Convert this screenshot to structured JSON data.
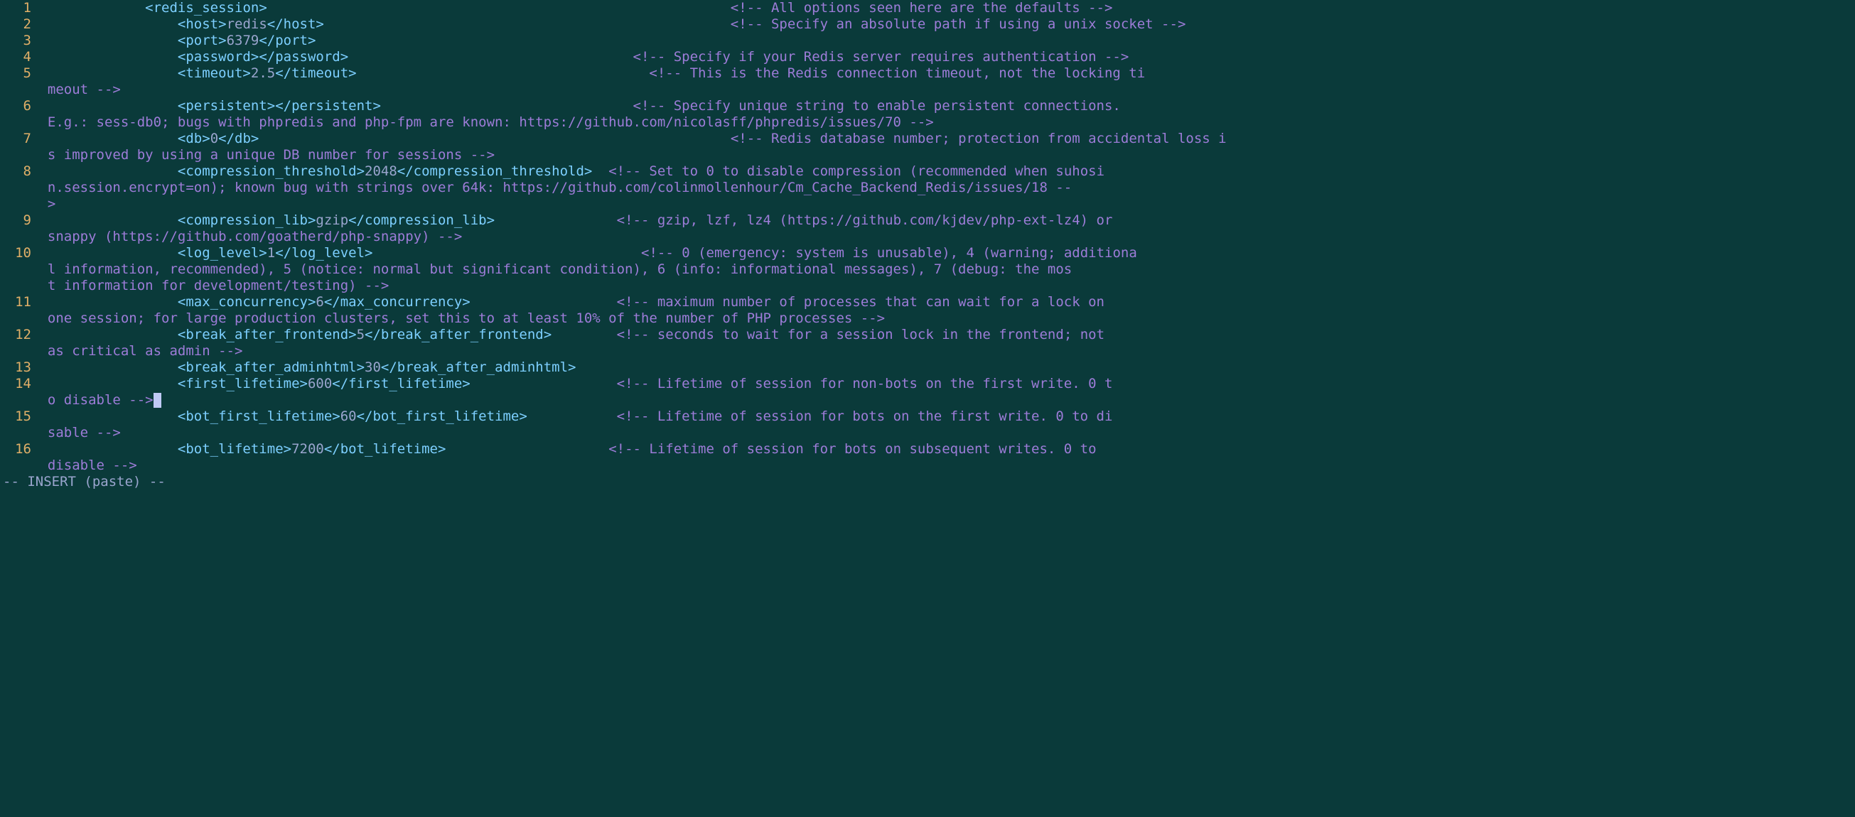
{
  "lines": [
    {
      "n": "1",
      "col1": "            <redis_session>",
      "val": "",
      "close": "",
      "pad": "                                                         ",
      "comment": "<!-- All options seen here are the defaults -->",
      "wraps": []
    },
    {
      "n": "2",
      "col1": "                <host>",
      "val": "redis",
      "close": "</host>",
      "pad": "                                                  ",
      "comment": "<!-- Specify an absolute path if using a unix socket -->",
      "wraps": []
    },
    {
      "n": "3",
      "col1": "                <port>",
      "val": "6379",
      "close": "</port>",
      "pad": "",
      "comment": "",
      "wraps": []
    },
    {
      "n": "4",
      "col1": "                <password>",
      "val": "",
      "close": "</password>",
      "pad": "                                   ",
      "comment": "<!-- Specify if your Redis server requires authentication -->",
      "wraps": []
    },
    {
      "n": "5",
      "col1": "                <timeout>",
      "val": "2.5",
      "close": "</timeout>",
      "pad": "                                    ",
      "comment": "<!-- This is the Redis connection timeout, not the locking ti",
      "wraps": [
        "meout -->"
      ]
    },
    {
      "n": "6",
      "col1": "                <persistent>",
      "val": "",
      "close": "</persistent>",
      "pad": "                               ",
      "comment": "<!-- Specify unique string to enable persistent connections. ",
      "wraps": [
        "E.g.: sess-db0; bugs with phpredis and php-fpm are known: https://github.com/nicolasff/phpredis/issues/70 -->"
      ]
    },
    {
      "n": "7",
      "col1": "                <db>",
      "val": "0",
      "close": "</db>",
      "pad": "                                                          ",
      "comment": "<!-- Redis database number; protection from accidental loss i",
      "wraps": [
        "s improved by using a unique DB number for sessions -->"
      ]
    },
    {
      "n": "8",
      "col1": "                <compression_threshold>",
      "val": "2048",
      "close": "</compression_threshold>",
      "pad": "  ",
      "comment": "<!-- Set to 0 to disable compression (recommended when suhosi",
      "wraps": [
        "n.session.encrypt=on); known bug with strings over 64k: https://github.com/colinmollenhour/Cm_Cache_Backend_Redis/issues/18 --",
        ">"
      ]
    },
    {
      "n": "9",
      "col1": "                <compression_lib>",
      "val": "gzip",
      "close": "</compression_lib>",
      "pad": "               ",
      "comment": "<!-- gzip, lzf, lz4 (https://github.com/kjdev/php-ext-lz4) or ",
      "wraps": [
        "snappy (https://github.com/goatherd/php-snappy) -->"
      ]
    },
    {
      "n": "10",
      "col1": "                <log_level>",
      "val": "1",
      "close": "</log_level>",
      "pad": "                                 ",
      "comment": "<!-- 0 (emergency: system is unusable), 4 (warning; additiona",
      "wraps": [
        "l information, recommended), 5 (notice: normal but significant condition), 6 (info: informational messages), 7 (debug: the mos",
        "t information for development/testing) -->"
      ]
    },
    {
      "n": "11",
      "col1": "                <max_concurrency>",
      "val": "6",
      "close": "</max_concurrency>",
      "pad": "                  ",
      "comment": "<!-- maximum number of processes that can wait for a lock on ",
      "wraps": [
        "one session; for large production clusters, set this to at least 10% of the number of PHP processes -->"
      ]
    },
    {
      "n": "12",
      "col1": "                <break_after_frontend>",
      "val": "5",
      "close": "</break_after_frontend>",
      "pad": "        ",
      "comment": "<!-- seconds to wait for a session lock in the frontend; not ",
      "wraps": [
        "as critical as admin -->"
      ]
    },
    {
      "n": "13",
      "col1": "                <break_after_adminhtml>",
      "val": "30",
      "close": "</break_after_adminhtml>",
      "pad": "",
      "comment": "",
      "wraps": []
    },
    {
      "n": "14",
      "col1": "                <first_lifetime>",
      "val": "600",
      "close": "</first_lifetime>",
      "pad": "                  ",
      "comment": "<!-- Lifetime of session for non-bots on the first write. 0 t",
      "wraps": [
        "o disable -->"
      ],
      "cursorAfterWrap": true
    },
    {
      "n": "15",
      "col1": "                <bot_first_lifetime>",
      "val": "60",
      "close": "</bot_first_lifetime>",
      "pad": "           ",
      "comment": "<!-- Lifetime of session for bots on the first write. 0 to di",
      "wraps": [
        "sable -->"
      ]
    },
    {
      "n": "16",
      "col1": "                <bot_lifetime>",
      "val": "7200",
      "close": "</bot_lifetime>",
      "pad": "                    ",
      "comment": "<!-- Lifetime of session for bots on subsequent writes. 0 to ",
      "wraps": [
        "disable -->"
      ]
    }
  ],
  "status": "-- INSERT (paste) --"
}
